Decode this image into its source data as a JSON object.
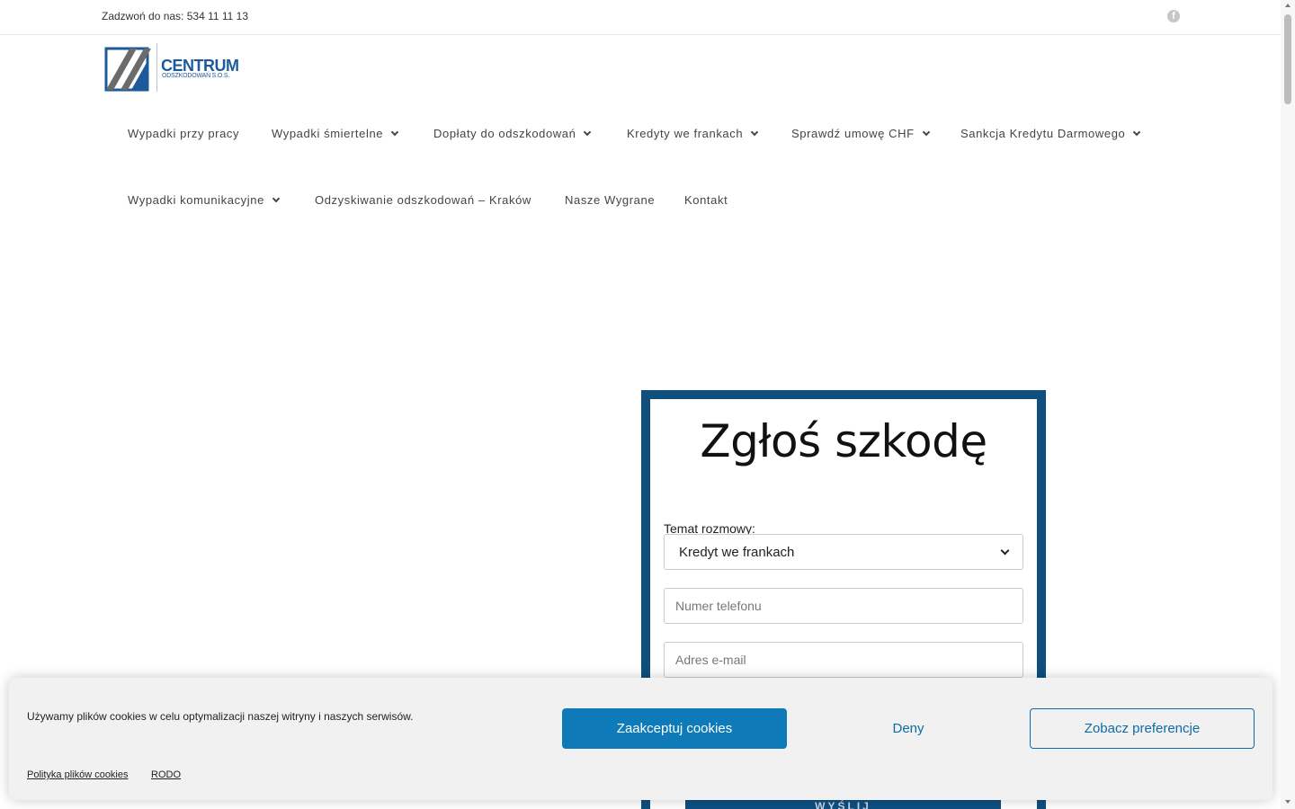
{
  "topbar": {
    "phone": "Zadzwoń do nas: 534 11 11 13",
    "social_icon": "facebook-icon"
  },
  "logo": {
    "brand": "CENTRUM",
    "sub": "ODSZKODOWAŃ S.O.S.",
    "colors": {
      "blue": "#1e5a9a",
      "gray": "#6b6b6b"
    }
  },
  "nav": {
    "items": [
      {
        "label": "Wypadki przy pracy",
        "has_dropdown": false
      },
      {
        "label": "Wypadki śmiertelne",
        "has_dropdown": true
      },
      {
        "label": "Dopłaty do odszkodowań",
        "has_dropdown": true
      },
      {
        "label": "Kredyty we frankach",
        "has_dropdown": true
      },
      {
        "label": "Sprawdź umowę CHF",
        "has_dropdown": true
      },
      {
        "label": "Sankcja Kredytu Darmowego",
        "has_dropdown": true
      },
      {
        "label": "Wypadki komunikacyjne",
        "has_dropdown": true
      },
      {
        "label": "Odzyskiwanie odszkodowań – Kraków",
        "has_dropdown": false
      },
      {
        "label": "Nasze Wygrane",
        "has_dropdown": false
      },
      {
        "label": "Kontakt",
        "has_dropdown": false
      }
    ]
  },
  "form": {
    "title": "Zgłoś szkodę",
    "topic_label": "Temat rozmowy:",
    "topic_value": "Kredyt we frankach",
    "phone_placeholder": "Numer telefonu",
    "email_placeholder": "Adres e-mail",
    "submit_label": "WYŚLIJ",
    "border_color": "#0e4f80"
  },
  "cookie": {
    "message": "Używamy plików cookies w celu optymalizacji naszej witryny i naszych serwisów.",
    "accept_label": "Zaakceptuj cookies",
    "deny_label": "Deny",
    "prefs_label": "Zobacz preferencje",
    "policy_link": "Polityka plików cookies",
    "rodo_link": "RODO",
    "accent_color": "#0e7ab8"
  }
}
